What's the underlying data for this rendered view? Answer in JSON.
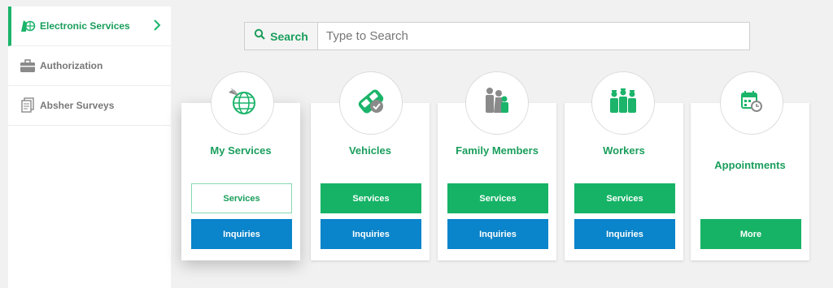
{
  "sidebar": {
    "items": [
      {
        "label": "Electronic Services",
        "icon": "electronic-services-icon",
        "active": true
      },
      {
        "label": "Authorization",
        "icon": "briefcase-icon",
        "active": false
      },
      {
        "label": "Absher Surveys",
        "icon": "documents-icon",
        "active": false
      }
    ]
  },
  "search": {
    "button_label": "Search",
    "placeholder": "Type to Search",
    "value": ""
  },
  "cards": [
    {
      "title": "My Services",
      "icon": "globe-icon",
      "buttons": [
        "Services",
        "Inquiries"
      ]
    },
    {
      "title": "Vehicles",
      "icon": "car-check-icon",
      "buttons": [
        "Services",
        "Inquiries"
      ]
    },
    {
      "title": "Family Members",
      "icon": "family-icon",
      "buttons": [
        "Services",
        "Inquiries"
      ]
    },
    {
      "title": "Workers",
      "icon": "workers-icon",
      "buttons": [
        "Services",
        "Inquiries"
      ]
    },
    {
      "title": "Appointments",
      "icon": "calendar-clock-icon",
      "buttons": [
        "More"
      ]
    }
  ],
  "colors": {
    "brand_green": "#1a9e5c",
    "button_green": "#16b366",
    "button_blue": "#0a84ca",
    "background": "#f1f1f1"
  }
}
